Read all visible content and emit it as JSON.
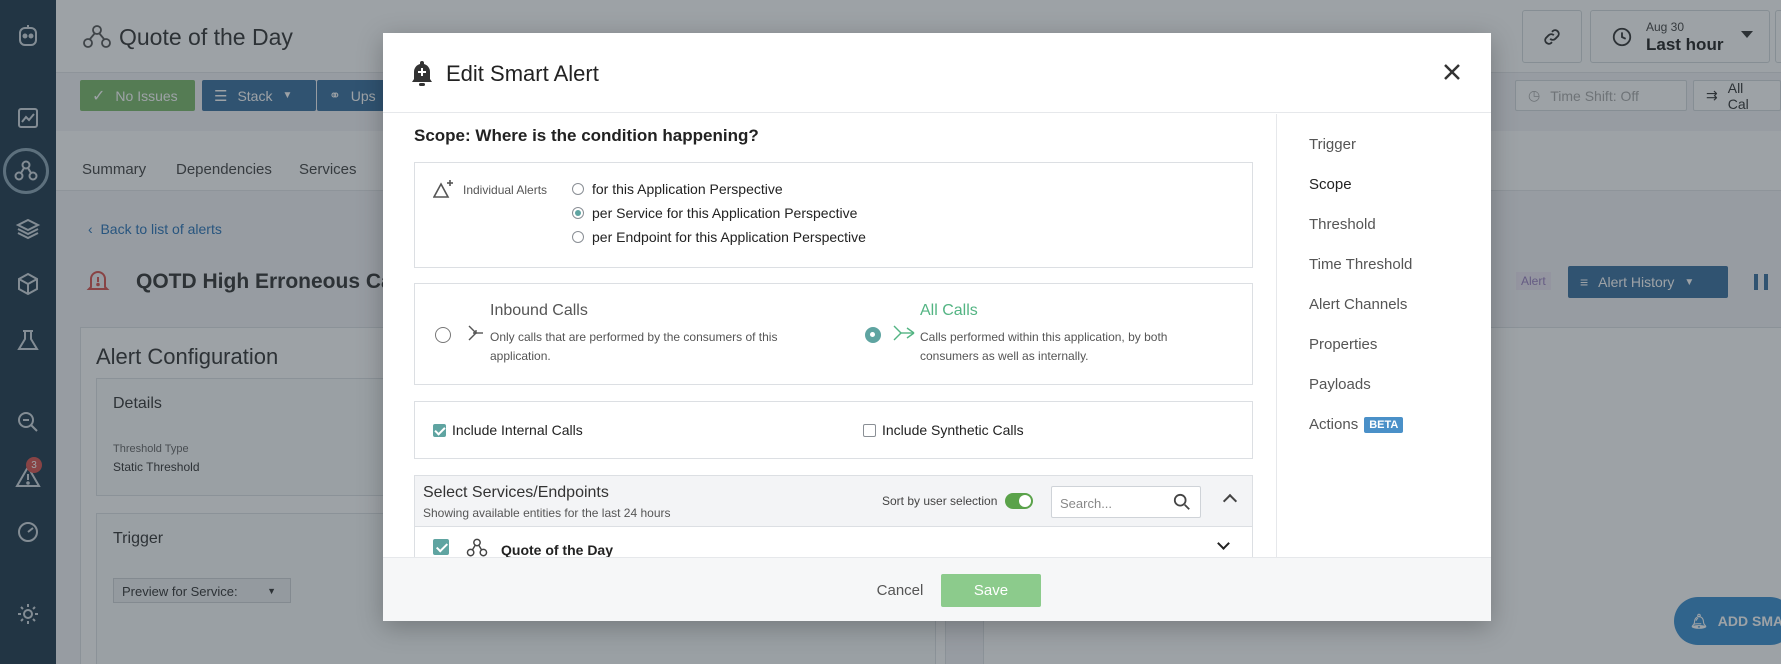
{
  "app": {
    "page_title": "Quote of the Day",
    "time_label": "Aug 30",
    "time_value": "Last hour",
    "time_shift": "Time Shift: Off",
    "all_calls_short": "All Cal",
    "add_smart_alert": "ADD SMA",
    "alert_badge_count": "3"
  },
  "toolbar": {
    "no_issues": "No Issues",
    "stack": "Stack",
    "upstream": "Ups"
  },
  "tabs": [
    "Summary",
    "Dependencies",
    "Services"
  ],
  "page": {
    "back_link": "Back to list of alerts",
    "alert_name": "QOTD High Erroneous Cal",
    "alert_tag": "Alert",
    "alert_history": "Alert History",
    "config_heading": "Alert Configuration",
    "details_heading": "Details",
    "threshold_type_label": "Threshold Type",
    "threshold_type_value": "Static Threshold",
    "trigger_heading": "Trigger",
    "preview_for_service": "Preview for Service:"
  },
  "modal": {
    "title": "Edit Smart Alert",
    "scope_title": "Scope: Where is the condition happening?",
    "individual_alerts_label": "Individual Alerts",
    "individual_options": [
      {
        "label": "for this Application Perspective",
        "selected": false
      },
      {
        "label": "per Service for this Application Perspective",
        "selected": true
      },
      {
        "label": "per Endpoint for this Application Perspective",
        "selected": false
      }
    ],
    "inbound": {
      "title": "Inbound Calls",
      "description": "Only calls that are performed by the consumers of this application.",
      "selected": false
    },
    "all_calls": {
      "title": "All Calls",
      "description": "Calls performed within this application, by both consumers as well as internally.",
      "selected": true
    },
    "include_internal": {
      "label": "Include Internal Calls",
      "checked": true
    },
    "include_synthetic": {
      "label": "Include Synthetic Calls",
      "checked": false
    },
    "select_services": {
      "title": "Select Services/Endpoints",
      "subtitle": "Showing available entities for the last 24 hours",
      "sort_label": "Sort by user selection",
      "search_placeholder": "Search...",
      "rows": [
        {
          "label": "Quote of the Day",
          "checked": true
        }
      ]
    },
    "side_nav": [
      {
        "label": "Trigger",
        "active": false
      },
      {
        "label": "Scope",
        "active": true
      },
      {
        "label": "Threshold",
        "active": false
      },
      {
        "label": "Time Threshold",
        "active": false
      },
      {
        "label": "Alert Channels",
        "active": false
      },
      {
        "label": "Properties",
        "active": false
      },
      {
        "label": "Payloads",
        "active": false
      },
      {
        "label": "Actions",
        "active": false,
        "badge": "BETA"
      }
    ],
    "cancel_label": "Cancel",
    "save_label": "Save"
  },
  "colors": {
    "nav_bg": "#1f3a4d",
    "accent_teal": "#5fa4a1",
    "all_calls_green": "#53b483",
    "save_green": "#8ccb8c",
    "beta_blue": "#4a90c8",
    "toggle_green": "#5aa24a"
  }
}
